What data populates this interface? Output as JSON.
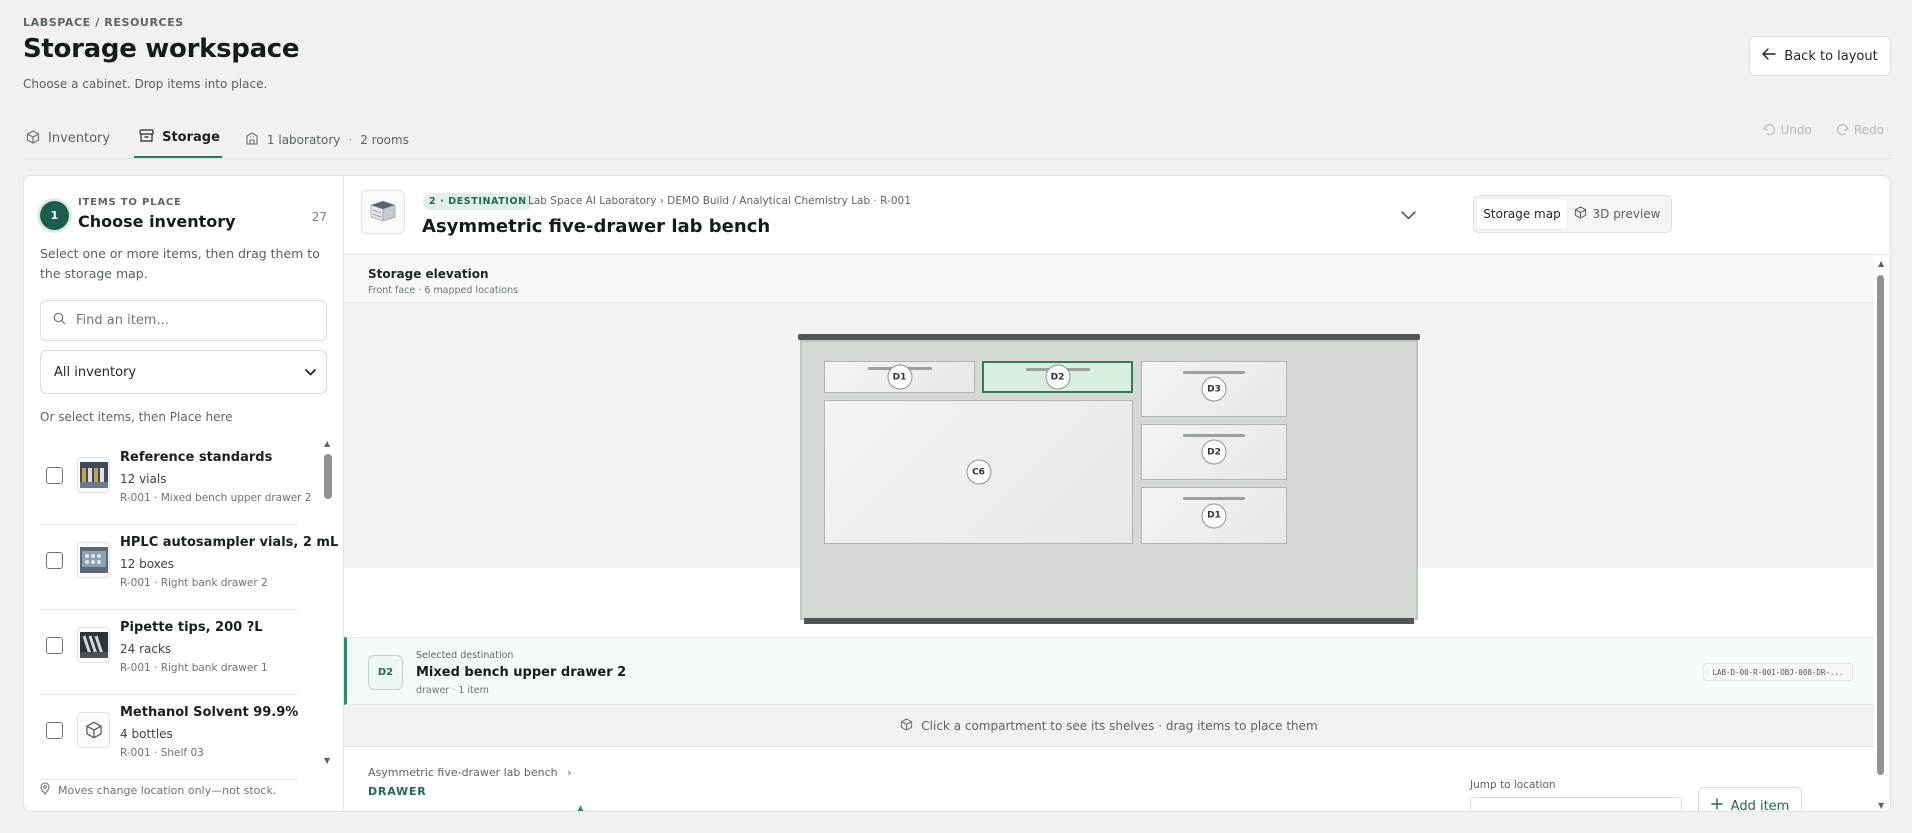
{
  "header": {
    "breadcrumb": "LABSPACE / RESOURCES",
    "title": "Storage workspace",
    "subtitle": "Choose a cabinet. Drop items into place.",
    "back_label": "Back to layout"
  },
  "tabs": [
    {
      "label": "Inventory",
      "icon": "box-icon"
    },
    {
      "label": "Storage",
      "icon": "archive-icon"
    }
  ],
  "scope": {
    "labs": "1 laboratory",
    "separator": "·",
    "rooms": "2 rooms",
    "icon": "building-icon"
  },
  "history": {
    "undo": "Undo",
    "redo": "Redo"
  },
  "left": {
    "step": "1",
    "items_label": "ITEMS TO PLACE",
    "title": "Choose inventory",
    "count": "27",
    "help": "Select one or more items, then drag them to the storage map.",
    "search_placeholder": "Find an item...",
    "filter_value": "All inventory",
    "or_select": "Or select items, then Place here",
    "items": [
      {
        "name": "Reference standards",
        "qty": "12 vials",
        "loc": "R-001 · Mixed bench upper drawer 2"
      },
      {
        "name": "HPLC autosampler vials, 2 mL",
        "qty": "12 boxes",
        "loc": "R-001 · Right bank drawer 2"
      },
      {
        "name": "Pipette tips, 200 ?L",
        "qty": "24 racks",
        "loc": "R-001 · Right bank drawer 1"
      },
      {
        "name": "Methanol Solvent 99.9%",
        "qty": "4 bottles",
        "loc": "R-001 · Shelf 03"
      }
    ],
    "footnote": "Moves change location only—not stock."
  },
  "destination": {
    "pill": "2 · DESTINATION",
    "path": "Lab Space AI Laboratory › DEMO Build / Analytical Chemistry Lab · R-001",
    "title": "Asymmetric five-drawer lab bench",
    "view_map": "Storage map",
    "view_3d": "3D preview"
  },
  "elevation": {
    "title": "Storage elevation",
    "subtitle": "Front face · 6 mapped locations",
    "compartments": {
      "top_left": "D1",
      "top_mid": "D2",
      "right_1": "D3",
      "right_2": "D2",
      "right_3": "D1",
      "cabinet": "C6"
    }
  },
  "selected": {
    "label": "Selected destination",
    "badge": "D2",
    "name": "Mixed bench upper drawer 2",
    "meta": "drawer · 1 item",
    "code": "LAB-D-00-R-001-OBJ-008-DR-..."
  },
  "hint": "Click a compartment to see its shelves · drag items to place them",
  "detail": {
    "crumb": "Asymmetric five-drawer lab bench",
    "section": "DRAWER",
    "jump_label": "Jump to location",
    "add_label": "Add item"
  },
  "colors": {
    "accent": "#1f7b67",
    "selected_fill": "#d8efdf",
    "selected_border": "#2f7a5d"
  }
}
